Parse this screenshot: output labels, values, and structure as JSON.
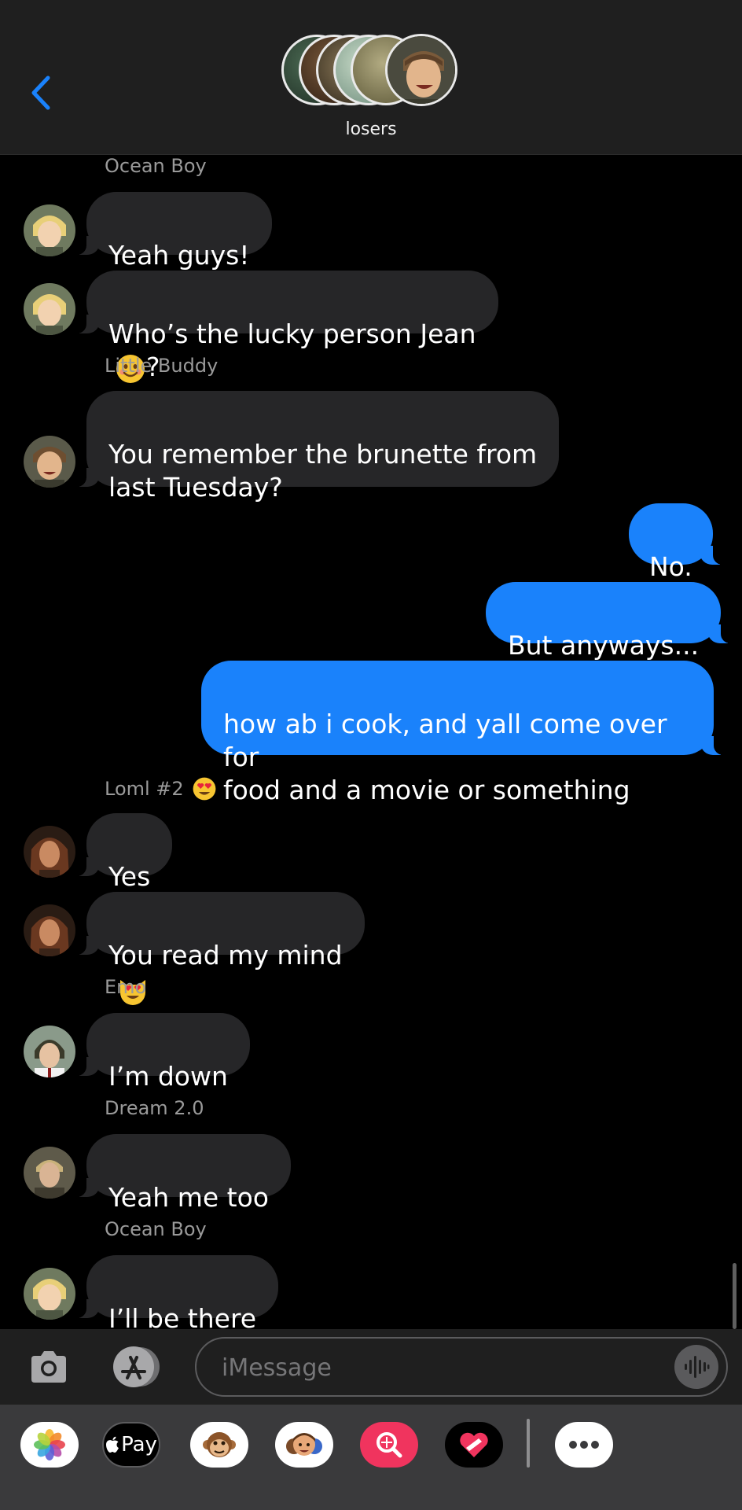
{
  "header": {
    "back_label": "<",
    "group_name": "losers"
  },
  "messages": [
    {
      "sender": "Ocean Boy",
      "text": "Yeah guys!"
    },
    {
      "text": "Who’s the lucky person Jean",
      "suffix": "?"
    },
    {
      "sender": "Little Buddy",
      "text": "You remember the brunette from\nlast Tuesday?"
    },
    {
      "text": "No."
    },
    {
      "text": "But anyways..."
    },
    {
      "text": "how ab i cook, and yall come over for\nfood and a movie or something"
    },
    {
      "sender": "Loml #2",
      "text": "Yes"
    },
    {
      "text": "You read my mind"
    },
    {
      "sender": "Emo",
      "text": "I’m down"
    },
    {
      "sender": "Dream 2.0",
      "text": "Yeah me too"
    },
    {
      "sender": "Ocean Boy",
      "text": "I’ll be there"
    }
  ],
  "input": {
    "placeholder": "iMessage"
  },
  "apps": {
    "apple_pay_label": "Pay"
  },
  "colors": {
    "accent": "#1a82fb",
    "incoming_bubble": "#262628",
    "header_bg": "#1f1f1f",
    "drawer_bg": "#3a3a3c"
  },
  "icons": [
    "chevron-left-icon",
    "camera-icon",
    "app-store-icon",
    "audio-waveform-icon",
    "photos-icon",
    "apple-pay-icon",
    "monkey-memoji-icon",
    "memoji-icon",
    "image-search-icon",
    "digital-touch-icon",
    "more-icon"
  ]
}
